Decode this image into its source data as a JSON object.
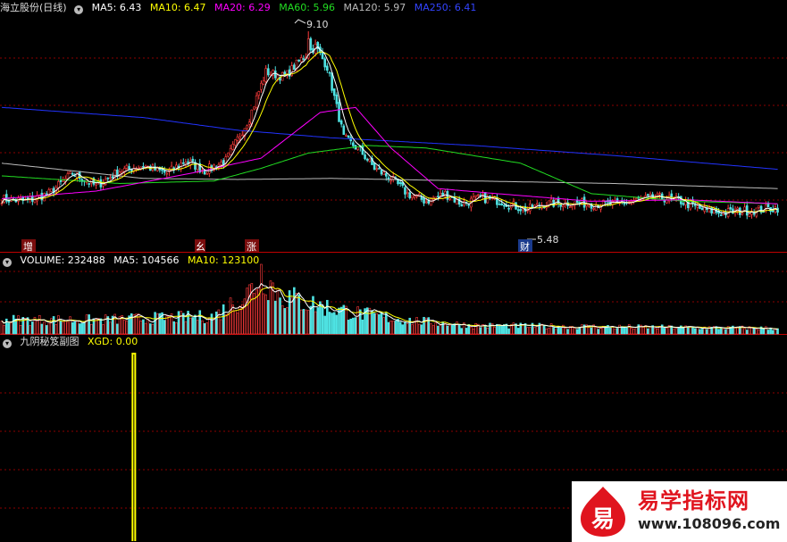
{
  "colors": {
    "background": "#000000",
    "up": "#ff3b3b",
    "down": "#4fe3e3",
    "ma5": "#ffffff",
    "ma10": "#ffff00",
    "ma20": "#ff00ff",
    "ma60": "#22dd22",
    "ma120": "#bbbbbb",
    "ma250": "#2233ff",
    "signal": "#ffff00",
    "grid": "#8b0000",
    "separator": "#c00000"
  },
  "price_panel": {
    "stock_name": "海立股份(日线)",
    "legend": [
      {
        "label": "MA5:",
        "value": "6.43",
        "color": "#ffffff"
      },
      {
        "label": "MA10:",
        "value": "6.47",
        "color": "#ffff00"
      },
      {
        "label": "MA20:",
        "value": "6.29",
        "color": "#ff00ff"
      },
      {
        "label": "MA60:",
        "value": "5.96",
        "color": "#22dd22"
      },
      {
        "label": "MA120:",
        "value": "5.97",
        "color": "#bbbbbb"
      },
      {
        "label": "MA250:",
        "value": "6.41",
        "color": "#2233ff"
      }
    ],
    "high_label": "9.10",
    "low_label": "5.48",
    "markers": [
      "增",
      "幺",
      "涨",
      "财"
    ]
  },
  "volume_panel": {
    "legend": [
      {
        "label": "VOLUME:",
        "value": "232488",
        "color": "#ffffff"
      },
      {
        "label": "MA5:",
        "value": "104566",
        "color": "#ffffff"
      },
      {
        "label": "MA10:",
        "value": "123100",
        "color": "#ffff00"
      }
    ]
  },
  "indicator_panel": {
    "name": "九阴秘笈副图",
    "legend": [
      {
        "label": "XGD:",
        "value": "0.00",
        "color": "#ffff00"
      }
    ]
  },
  "watermark": {
    "logo_char": "易",
    "title": "易学指标网",
    "url": "www.108096.com"
  },
  "chart_data": [
    {
      "type": "candlestick",
      "title": "海立股份(日线)",
      "price_range": [
        5.0,
        9.4
      ],
      "high": 9.1,
      "low": 5.48,
      "moving_averages": {
        "MA5": 6.43,
        "MA10": 6.47,
        "MA20": 6.29,
        "MA60": 5.96,
        "MA120": 5.97,
        "MA250": 6.41
      },
      "close_path": [
        {
          "i": 0,
          "v": 5.8
        },
        {
          "i": 10,
          "v": 5.75
        },
        {
          "i": 20,
          "v": 5.9
        },
        {
          "i": 30,
          "v": 6.3
        },
        {
          "i": 40,
          "v": 6.05
        },
        {
          "i": 50,
          "v": 6.35
        },
        {
          "i": 60,
          "v": 6.45
        },
        {
          "i": 70,
          "v": 6.3
        },
        {
          "i": 78,
          "v": 6.55
        },
        {
          "i": 86,
          "v": 6.35
        },
        {
          "i": 95,
          "v": 6.55
        },
        {
          "i": 105,
          "v": 7.4
        },
        {
          "i": 112,
          "v": 8.3
        },
        {
          "i": 120,
          "v": 8.2
        },
        {
          "i": 128,
          "v": 8.6
        },
        {
          "i": 133,
          "v": 8.8
        },
        {
          "i": 138,
          "v": 8.4
        },
        {
          "i": 145,
          "v": 7.0
        },
        {
          "i": 152,
          "v": 6.75
        },
        {
          "i": 158,
          "v": 6.4
        },
        {
          "i": 165,
          "v": 6.2
        },
        {
          "i": 172,
          "v": 5.9
        },
        {
          "i": 180,
          "v": 5.75
        },
        {
          "i": 188,
          "v": 5.9
        },
        {
          "i": 195,
          "v": 5.7
        },
        {
          "i": 203,
          "v": 5.82
        },
        {
          "i": 212,
          "v": 5.75
        },
        {
          "i": 222,
          "v": 5.58
        },
        {
          "i": 230,
          "v": 5.7
        },
        {
          "i": 240,
          "v": 5.72
        },
        {
          "i": 250,
          "v": 5.7
        },
        {
          "i": 260,
          "v": 5.68
        },
        {
          "i": 270,
          "v": 5.78
        },
        {
          "i": 280,
          "v": 5.82
        },
        {
          "i": 288,
          "v": 5.75
        },
        {
          "i": 296,
          "v": 5.6
        },
        {
          "i": 305,
          "v": 5.52
        },
        {
          "i": 315,
          "v": 5.56
        },
        {
          "i": 324,
          "v": 5.6
        },
        {
          "i": 329,
          "v": 5.62
        }
      ],
      "ma_paths": {
        "MA120": [
          [
            0,
            6.5
          ],
          [
            60,
            6.2
          ],
          [
            100,
            6.18
          ],
          [
            140,
            6.2
          ],
          [
            200,
            6.15
          ],
          [
            260,
            6.1
          ],
          [
            329,
            6.0
          ]
        ],
        "MA250": [
          [
            0,
            7.6
          ],
          [
            60,
            7.4
          ],
          [
            100,
            7.15
          ],
          [
            140,
            7.0
          ],
          [
            200,
            6.85
          ],
          [
            260,
            6.65
          ],
          [
            329,
            6.38
          ]
        ],
        "MA60": [
          [
            0,
            6.25
          ],
          [
            50,
            6.1
          ],
          [
            90,
            6.15
          ],
          [
            110,
            6.4
          ],
          [
            130,
            6.7
          ],
          [
            155,
            6.85
          ],
          [
            180,
            6.8
          ],
          [
            220,
            6.5
          ],
          [
            250,
            5.9
          ],
          [
            290,
            5.75
          ],
          [
            329,
            5.7
          ]
        ],
        "MA20": [
          [
            0,
            5.8
          ],
          [
            40,
            5.95
          ],
          [
            80,
            6.3
          ],
          [
            110,
            6.6
          ],
          [
            135,
            7.5
          ],
          [
            150,
            7.6
          ],
          [
            165,
            6.8
          ],
          [
            185,
            6.0
          ],
          [
            210,
            5.9
          ],
          [
            250,
            5.75
          ],
          [
            290,
            5.78
          ],
          [
            329,
            5.7
          ]
        ]
      },
      "volume_path": [
        {
          "i": 0,
          "v": 0.2
        },
        {
          "i": 40,
          "v": 0.2
        },
        {
          "i": 60,
          "v": 0.22
        },
        {
          "i": 90,
          "v": 0.25
        },
        {
          "i": 105,
          "v": 0.6
        },
        {
          "i": 110,
          "v": 0.9
        },
        {
          "i": 118,
          "v": 0.55
        },
        {
          "i": 135,
          "v": 0.4
        },
        {
          "i": 150,
          "v": 0.3
        },
        {
          "i": 170,
          "v": 0.2
        },
        {
          "i": 200,
          "v": 0.12
        },
        {
          "i": 260,
          "v": 0.1
        },
        {
          "i": 329,
          "v": 0.08
        }
      ],
      "signal": {
        "type": "line",
        "name": "XGD",
        "value": 0.0,
        "spike_at": 56,
        "spike_value": 1
      }
    }
  ]
}
